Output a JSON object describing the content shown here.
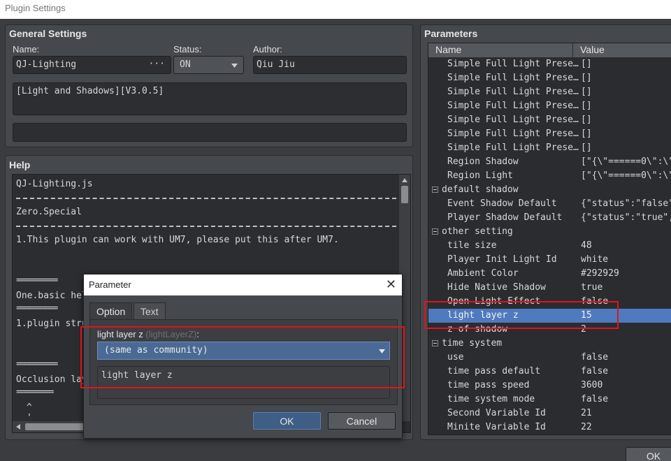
{
  "window": {
    "title": "Plugin Settings"
  },
  "general": {
    "title": "General Settings",
    "name_label": "Name:",
    "name_value": "QJ-Lighting",
    "name_more": "···",
    "status_label": "Status:",
    "status_value": "ON",
    "author_label": "Author:",
    "author_value": "Qiu Jiu",
    "description": "[Light and Shadows][V3.0.5]",
    "extra": ""
  },
  "help": {
    "title": "Help",
    "lines": [
      "QJ-Lighting.js",
      "Zero.Special",
      "1.This plugin can work with UM7, please put this after UM7.",
      "==========",
      "One.basic help",
      "==========",
      "1.plugin struc",
      "==========",
      "Occlusion laye",
      "=========",
      "^",
      "'"
    ]
  },
  "params": {
    "title": "Parameters",
    "col_name": "Name",
    "col_value": "Value",
    "rows": [
      {
        "name": "Simple Full Light Prese…",
        "value": "[]"
      },
      {
        "name": "Simple Full Light Prese…",
        "value": "[]"
      },
      {
        "name": "Simple Full Light Prese…",
        "value": "[]"
      },
      {
        "name": "Simple Full Light Prese…",
        "value": "[]"
      },
      {
        "name": "Simple Full Light Prese…",
        "value": "[]"
      },
      {
        "name": "Simple Full Light Prese…",
        "value": "[]"
      },
      {
        "name": "Simple Full Light Prese…",
        "value": "[]"
      },
      {
        "name": "Region Shadow",
        "value": "[\"{\\\"======0\\\":\\\"\\"
      },
      {
        "name": "Region Light",
        "value": "[\"{\\\"======0\\\":\\\"\\"
      },
      {
        "name": "default shadow",
        "value": "",
        "group": true
      },
      {
        "name": "Event Shadow Default",
        "value": "{\"status\":\"false\",\""
      },
      {
        "name": "Player Shadow Default",
        "value": "{\"status\":\"true\",\"i"
      },
      {
        "name": "other setting",
        "value": "",
        "group": true
      },
      {
        "name": "tile size",
        "value": "48"
      },
      {
        "name": "Player Init Light Id",
        "value": "white"
      },
      {
        "name": "Ambient Color",
        "value": "#292929"
      },
      {
        "name": "Hide Native Shadow",
        "value": "true"
      },
      {
        "name": "Open Light Effect",
        "value": "false"
      },
      {
        "name": "light layer z",
        "value": "15",
        "selected": true
      },
      {
        "name": "z of shadow",
        "value": "2"
      },
      {
        "name": "time system",
        "value": "",
        "group": true
      },
      {
        "name": "use",
        "value": "false"
      },
      {
        "name": "time pass default",
        "value": "false"
      },
      {
        "name": "time pass speed",
        "value": "3600"
      },
      {
        "name": "time system mode",
        "value": "false"
      },
      {
        "name": "Second Variable Id",
        "value": "21"
      },
      {
        "name": "Minite Variable Id",
        "value": "22"
      }
    ]
  },
  "dialog": {
    "title": "Parameter",
    "close": "✕",
    "tab_option": "Option",
    "tab_text": "Text",
    "param_label": "light layer z",
    "param_key": "(lightLayerZ)",
    "param_colon": ":",
    "combo_value": "(same as community)",
    "description": "light layer z",
    "ok": "OK",
    "cancel": "Cancel"
  },
  "footer": {
    "ok": "OK"
  }
}
